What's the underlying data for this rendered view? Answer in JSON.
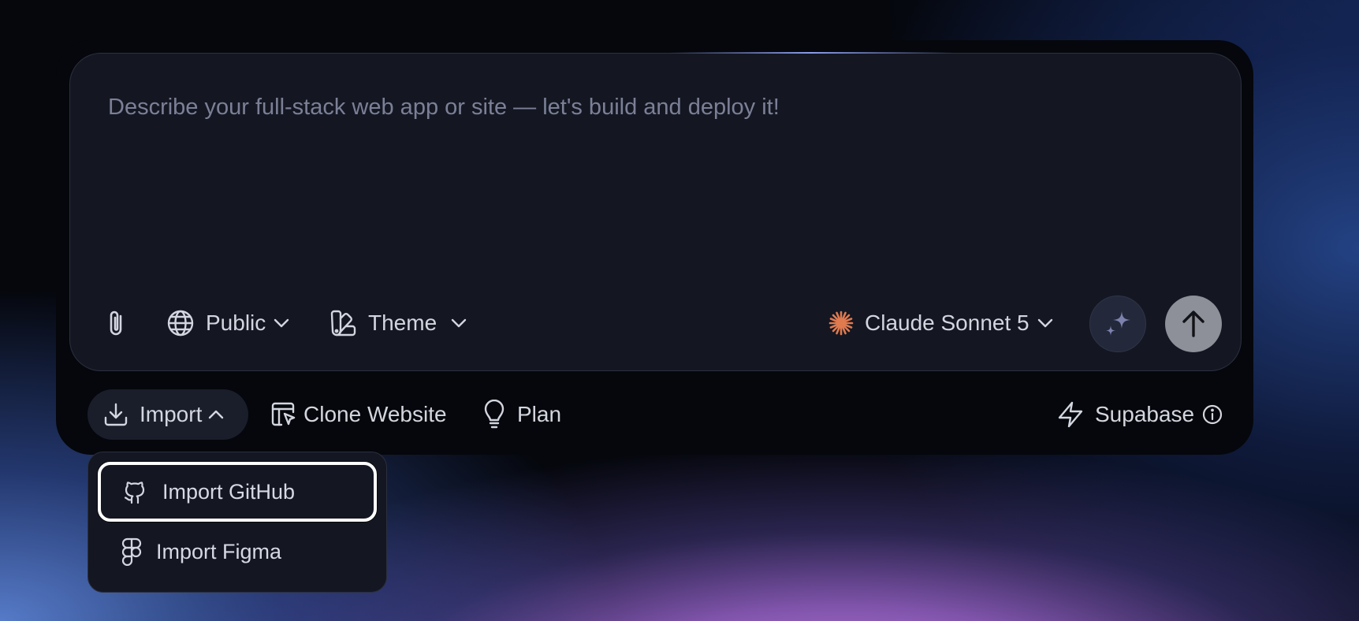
{
  "prompt": {
    "placeholder": "Describe your full-stack web app or site — let's build and deploy it!",
    "value": ""
  },
  "toolbar": {
    "attach_icon": "paperclip-icon",
    "visibility_label": "Public",
    "theme_label": "Theme",
    "model_label": "Claude Sonnet 5",
    "model_icon_color": "#e07a4f",
    "enhance_icon": "sparkles-icon",
    "send_icon": "arrow-up-icon"
  },
  "actions": {
    "import_label": "Import",
    "clone_label": "Clone Website",
    "plan_label": "Plan",
    "supabase_label": "Supabase"
  },
  "import_menu": {
    "items": [
      {
        "label": "Import GitHub",
        "icon": "github-icon"
      },
      {
        "label": "Import Figma",
        "icon": "figma-icon"
      }
    ]
  },
  "colors": {
    "panel": "#05070c",
    "prompt_box": "#141722",
    "send_button": "#8d8f99",
    "accent_glow": "#96aaff"
  }
}
